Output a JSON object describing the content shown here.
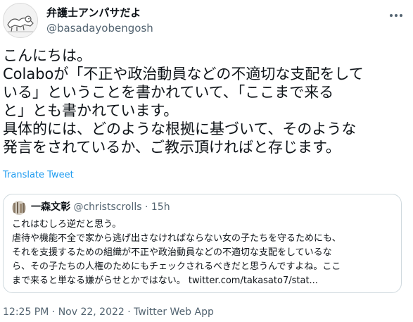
{
  "author": {
    "display_name": "弁護士アンパサだよ",
    "handle": "@basadayobengosh",
    "avatar_icon": "illustrated-avatar"
  },
  "tweet": {
    "lines": [
      "こんにちは。",
      "Colaboが「不正や政治動員などの不適切な支配をして",
      "いる」ということを書かれていて、「ここまで来る",
      "と」とも書かれています。",
      "具体的には、どのような根拠に基づいて、そのような",
      "発言をされているか、ご教示頂ければと存じます。"
    ],
    "translate_label": "Translate Tweet"
  },
  "quote": {
    "display_name": "一森文彰",
    "handle": "@christscrolls",
    "separator": "·",
    "time": "15h",
    "lines": [
      "これはむしろ逆だと思う。",
      "虐待や機能不全で家から逃げ出さなければならない女の子たちを守るためにも、",
      "それを支援するための組織が不正や政治動員などの不適切な支配をしているな",
      "ら、その子たちの人権のためにもチェックされるべきだと思うんですよね。ここ",
      "まで来ると単なる嫌がらせとかではない。 twitter.com/takasato7/stat..."
    ]
  },
  "meta": {
    "time": "12:25 PM",
    "sep1": "·",
    "date": "Nov 22, 2022",
    "sep2": "·",
    "source": "Twitter Web App"
  },
  "colors": {
    "text": "#0f1419",
    "secondary": "#536471",
    "link": "#1d9bf0",
    "border": "#cfd9de"
  }
}
